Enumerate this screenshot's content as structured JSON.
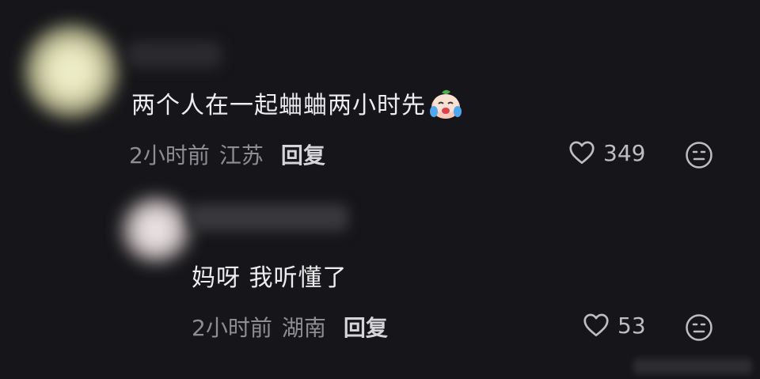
{
  "comments": [
    {
      "text": "两个人在一起蛐蛐两小时先",
      "time": "2小时前",
      "region": "江苏",
      "reply_label": "回复",
      "likes": "349",
      "emoji": "crying-laughing-baby-emoji"
    },
    {
      "text": "妈呀 我听懂了",
      "time": "2小时前",
      "region": "湖南",
      "reply_label": "回复",
      "likes": "53"
    }
  ],
  "icons": {
    "like": "heart-outline-icon",
    "dislike": "meh-face-icon"
  },
  "colors": {
    "background": "#16161a",
    "text": "#ededf0",
    "meta": "#8d8d94"
  }
}
